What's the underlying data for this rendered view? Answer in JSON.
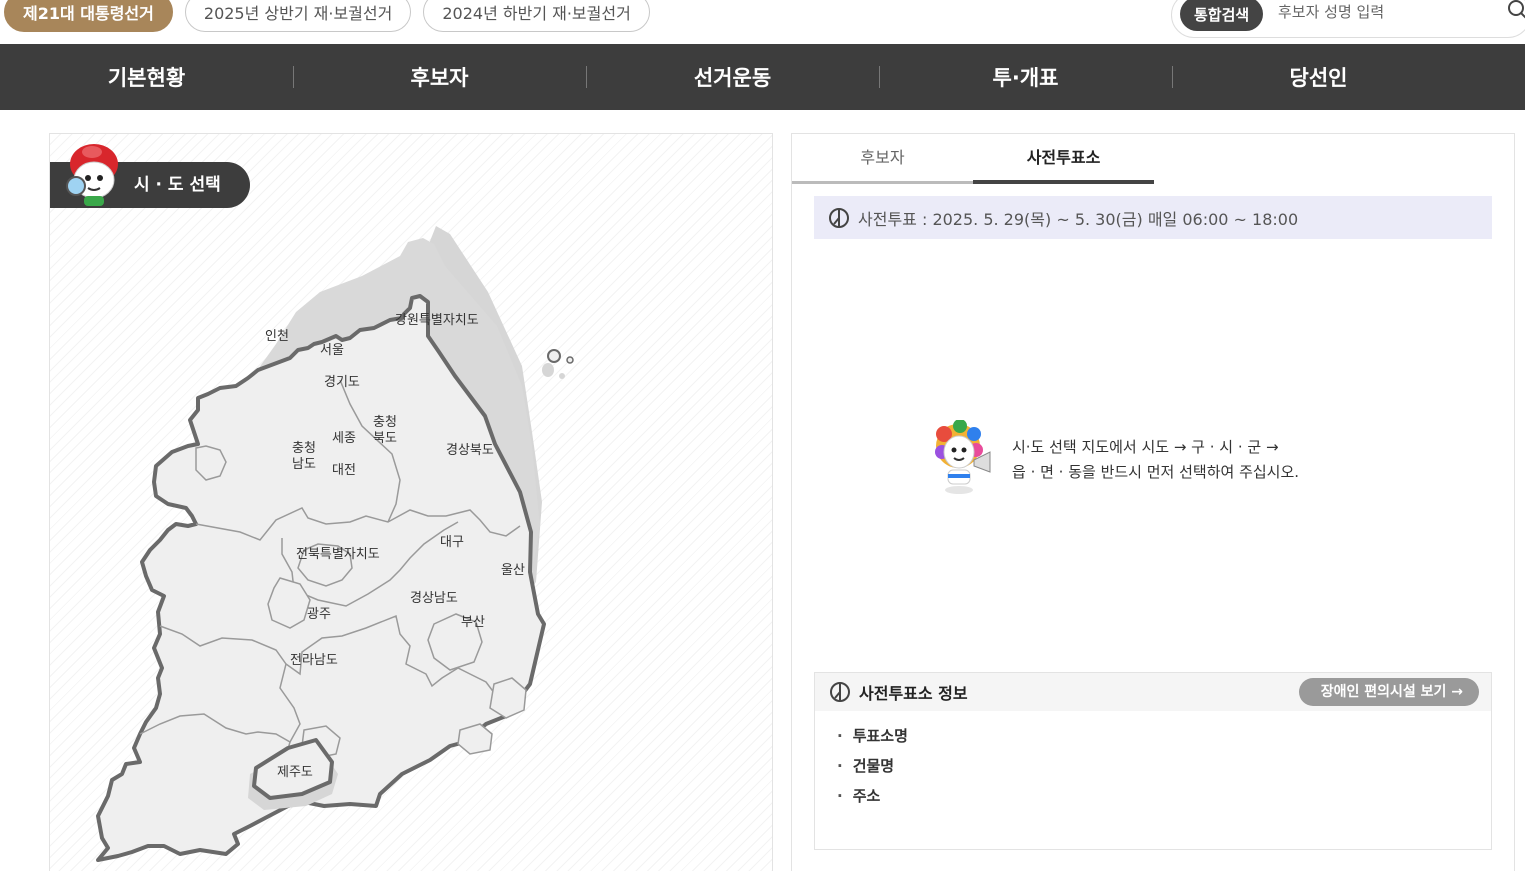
{
  "election_tabs": [
    {
      "label": "제21대 대통령선거"
    },
    {
      "label": "2025년 상반기 재·보궐선거"
    },
    {
      "label": "2024년 하반기 재·보궐선거"
    }
  ],
  "search": {
    "button_label": "통합검색",
    "placeholder": "후보자 성명 입력",
    "icon": "search-icon"
  },
  "nav": {
    "items": [
      {
        "label": "기본현황"
      },
      {
        "label": "후보자"
      },
      {
        "label": "선거운동"
      },
      {
        "label": "투·개표"
      },
      {
        "label": "당선인"
      }
    ]
  },
  "map_panel": {
    "badge_label": "시 · 도 선택",
    "regions": {
      "incheon": "인천",
      "seoul": "서울",
      "gyeonggi": "경기도",
      "gangwon": "강원특별자치도",
      "chungbuk_1": "충청",
      "chungbuk_2": "북도",
      "chungnam_1": "충청",
      "chungnam_2": "남도",
      "sejong": "세종",
      "daejeon": "대전",
      "gyeongbuk": "경상북도",
      "daegu": "대구",
      "jeonbuk": "전북특별자치도",
      "ulsan": "울산",
      "gwangju": "광주",
      "gyeongnam": "경상남도",
      "busan": "부산",
      "jeonnam": "전라남도",
      "jeju": "제주도"
    }
  },
  "info_panel": {
    "tabs": [
      {
        "label": "후보자"
      },
      {
        "label": "사전투표소"
      }
    ],
    "period_text": "사전투표 : 2025. 5. 29(목) ~ 5. 30(금) 매일 06:00 ~ 18:00",
    "guide_line1": "시·도 선택 지도에서 시도 → 구 · 시 · 군 →",
    "guide_line2": "읍 · 면 · 동을 반드시 먼저 선택하여 주십시오.",
    "place_title": "사전투표소 정보",
    "access_button": "장애인 편의시설 보기",
    "place_fields": [
      "투표소명",
      "건물명",
      "주소"
    ]
  },
  "colors": {
    "accent": "#a8865a",
    "nav_bg": "#3d3d3d",
    "period_bg": "#ebebf8"
  }
}
